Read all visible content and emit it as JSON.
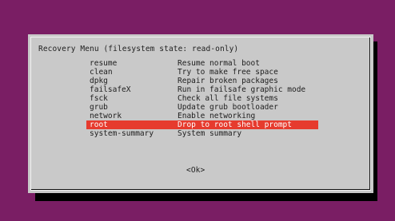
{
  "colors": {
    "background": "#7a1e64",
    "dialog": "#c9c9c9",
    "selection": "#e63b2e",
    "text": "#1e1e1e",
    "selected_text": "#ffffff"
  },
  "dialog": {
    "title": "Recovery Menu (filesystem state: read-only)",
    "items": [
      {
        "command": "resume",
        "description": "Resume normal boot",
        "selected": false
      },
      {
        "command": "clean",
        "description": "Try to make free space",
        "selected": false
      },
      {
        "command": "dpkg",
        "description": "Repair broken packages",
        "selected": false
      },
      {
        "command": "failsafeX",
        "description": "Run in failsafe graphic mode",
        "selected": false
      },
      {
        "command": "fsck",
        "description": "Check all file systems",
        "selected": false
      },
      {
        "command": "grub",
        "description": "Update grub bootloader",
        "selected": false
      },
      {
        "command": "network",
        "description": "Enable networking",
        "selected": false
      },
      {
        "command": "root",
        "description": "Drop to root shell prompt",
        "selected": true
      },
      {
        "command": "system-summary",
        "description": "System summary",
        "selected": false
      }
    ],
    "ok_label": "<Ok>"
  }
}
